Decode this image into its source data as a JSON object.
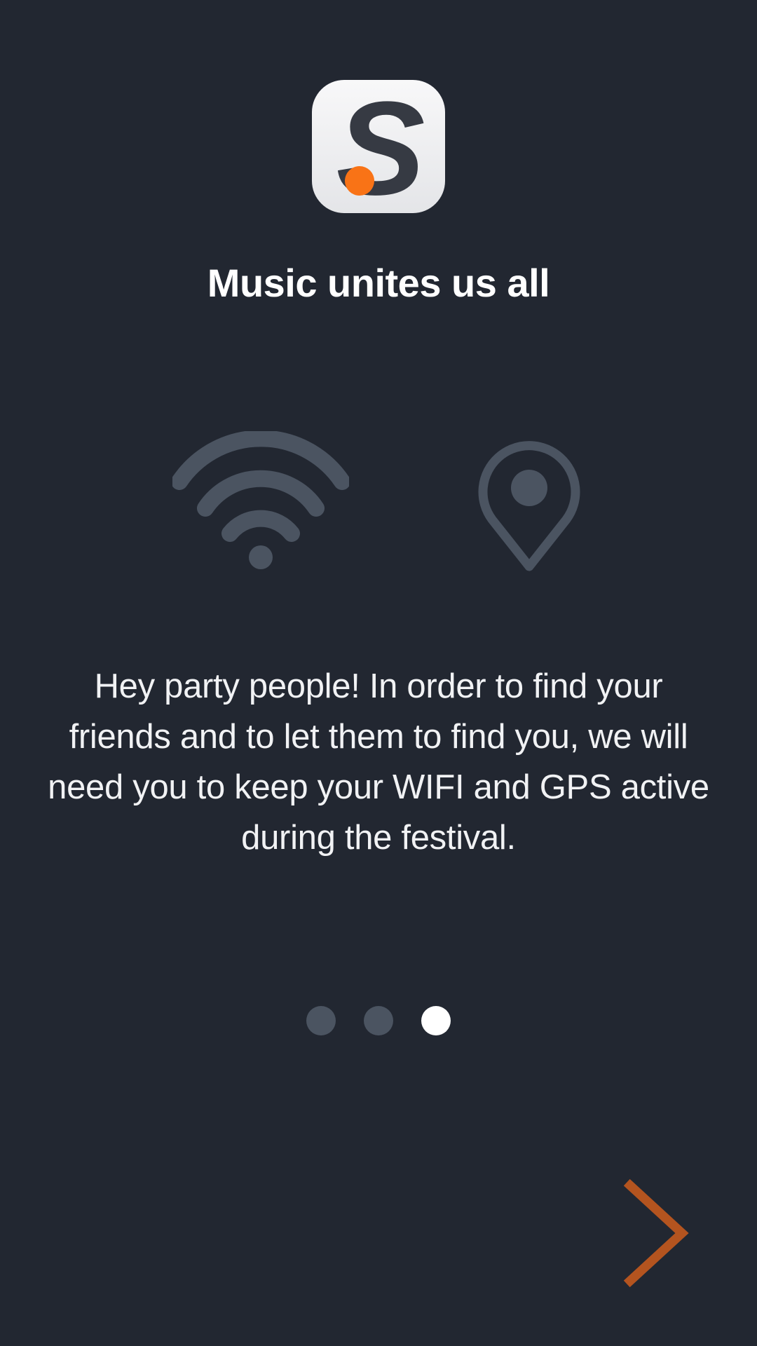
{
  "app": {
    "logo_letter": "S",
    "logo_icon": "s-dot-logo-icon"
  },
  "onboarding": {
    "title": "Music unites us all",
    "body": "Hey party people! In order to find your friends and to let them to find you, we will need you to keep your WIFI and GPS active during the festival.",
    "icons": [
      "wifi-icon",
      "location-pin-icon"
    ],
    "page_count": 3,
    "current_page": 3
  },
  "navigation": {
    "next_icon": "chevron-right-icon"
  },
  "colors": {
    "background": "#222731",
    "accent": "#f97316",
    "next_arrow": "#b4541f",
    "icon_muted": "#4b5461",
    "dot_inactive": "#4b5461",
    "dot_active": "#ffffff"
  }
}
